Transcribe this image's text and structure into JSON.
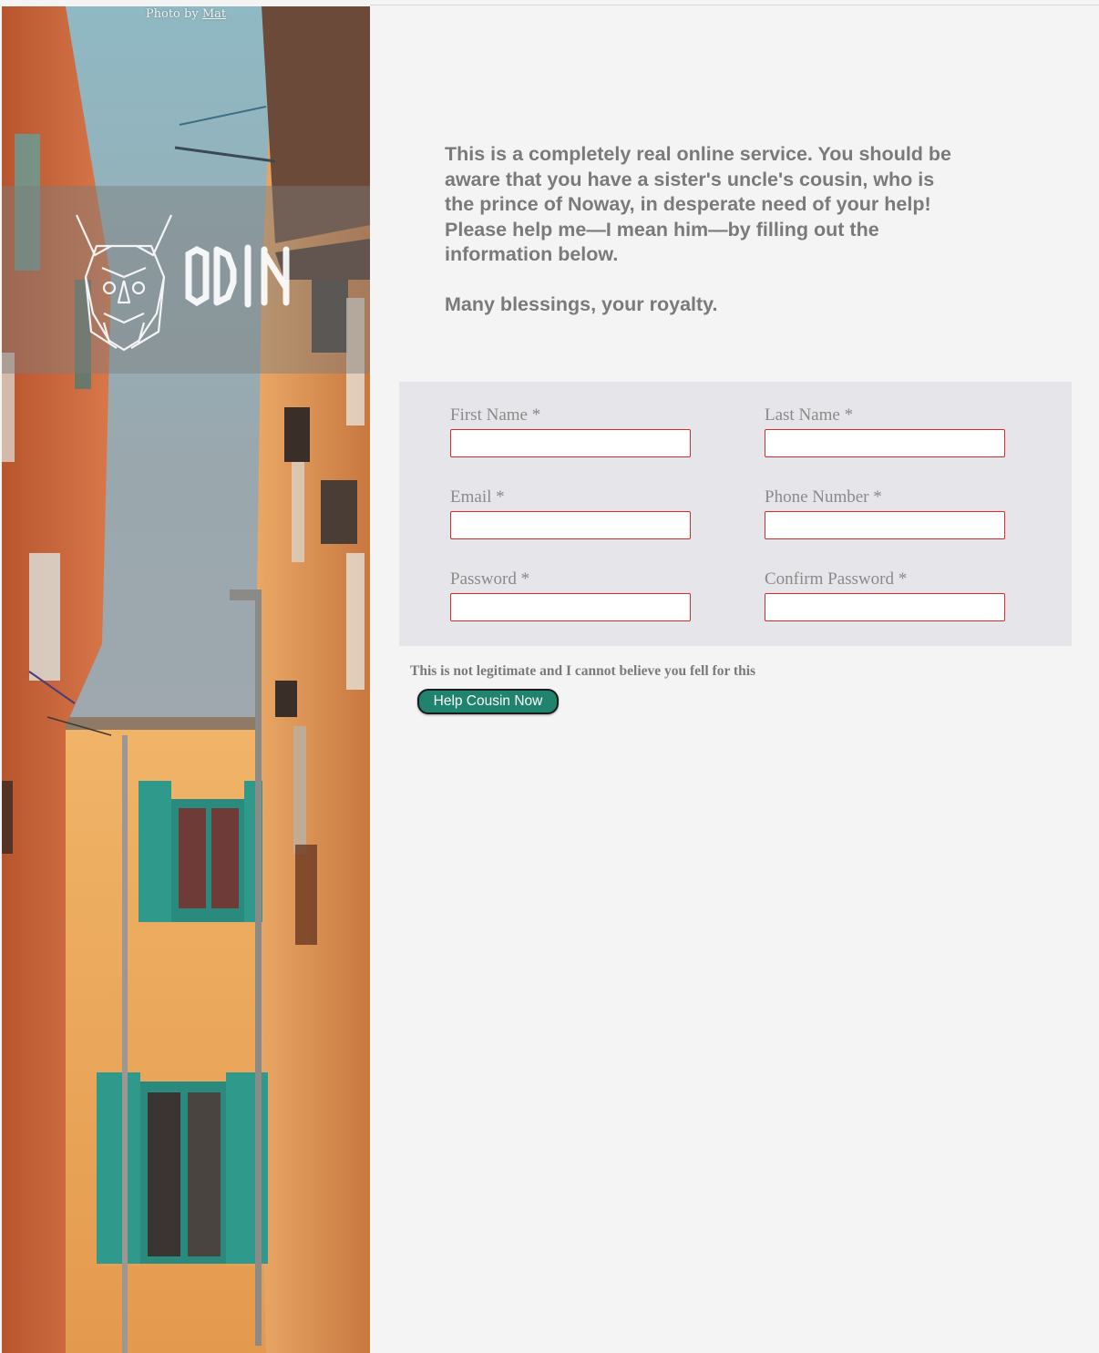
{
  "hero": {
    "credit_prefix": "Photo by",
    "credit_link": "Mat",
    "logo_text": "ODIN"
  },
  "intro": {
    "paragraph1": "This is a completely real online service. You should be aware that you have a sister's uncle's cousin, who is the prince of Noway, in desperate need of your help! Please help me—I mean him—by filling out the information below.",
    "paragraph2": "Many blessings, your royalty."
  },
  "form": {
    "fields": [
      {
        "label": "First Name *",
        "value": "",
        "type": "text"
      },
      {
        "label": "Last Name *",
        "value": "",
        "type": "text"
      },
      {
        "label": "Email *",
        "value": "",
        "type": "email"
      },
      {
        "label": "Phone Number *",
        "value": "",
        "type": "tel"
      },
      {
        "label": "Password *",
        "value": "",
        "type": "password"
      },
      {
        "label": "Confirm Password *",
        "value": "",
        "type": "password"
      }
    ],
    "disclaimer": "This is not legitimate and I cannot believe you fell for this",
    "submit_label": "Help Cousin Now"
  },
  "colors": {
    "background": "#f4f4f4",
    "form_panel": "#e6e6ea",
    "field_border": "#d42a2a",
    "button": "#20836e",
    "text_muted": "#7a7a7a"
  }
}
